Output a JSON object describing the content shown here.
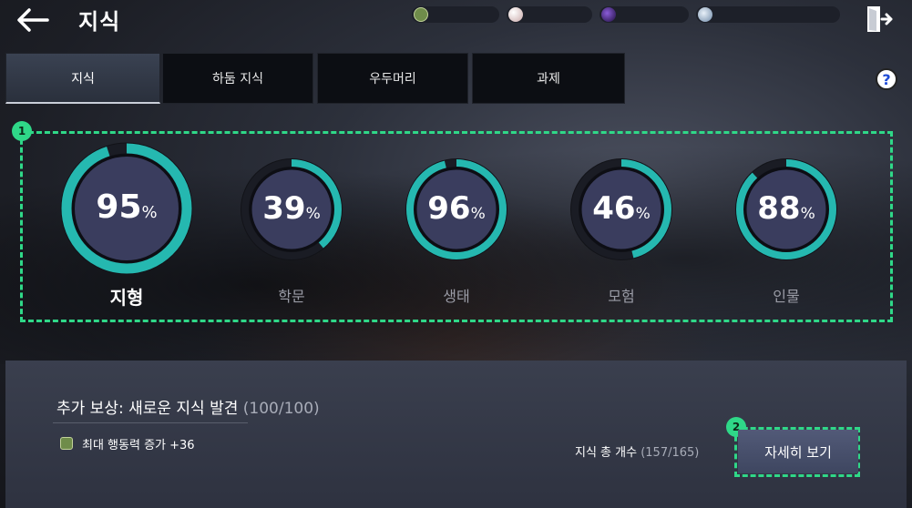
{
  "header": {
    "title": "지식",
    "back_icon": "arrow-left-icon",
    "exit_icon": "exit-door-icon"
  },
  "currencies": [
    {
      "icon": "green-hex-icon",
      "color": "#6f8c4a"
    },
    {
      "icon": "pearl-icon",
      "color": "#d9c9c9"
    },
    {
      "icon": "purple-orb-icon",
      "color": "#3a1e6e"
    },
    {
      "icon": "silver-coin-icon",
      "color": "#9db4cc"
    }
  ],
  "tabs": [
    {
      "label": "지식",
      "active": true
    },
    {
      "label": "하둠 지식",
      "active": false
    },
    {
      "label": "우두머리",
      "active": false
    },
    {
      "label": "과제",
      "active": false
    }
  ],
  "help": {
    "label": "?"
  },
  "highlights": {
    "first": "1",
    "second": "2"
  },
  "categories": [
    {
      "label": "지형",
      "value": "95",
      "unit": "%",
      "progress": 0.95,
      "selected": true
    },
    {
      "label": "학문",
      "value": "39",
      "unit": "%",
      "progress": 0.39,
      "selected": false
    },
    {
      "label": "생태",
      "value": "96",
      "unit": "%",
      "progress": 0.96,
      "selected": false
    },
    {
      "label": "모험",
      "value": "46",
      "unit": "%",
      "progress": 0.46,
      "selected": false
    },
    {
      "label": "인물",
      "value": "88",
      "unit": "%",
      "progress": 0.88,
      "selected": false
    }
  ],
  "reward": {
    "title": "추가 보상: 새로운 지식 발견",
    "count": "(100/100)",
    "bonus": "최대 행동력 증가 +36",
    "bonus_icon": "green-hex-icon"
  },
  "totals": {
    "label": "지식 총 개수",
    "count": "(157/165)"
  },
  "detail_button": {
    "label": "자세히 보기"
  },
  "colors": {
    "accent": "#2fd888",
    "ring_fill": "#25b8b0",
    "ring_track": "#1a1c24"
  }
}
